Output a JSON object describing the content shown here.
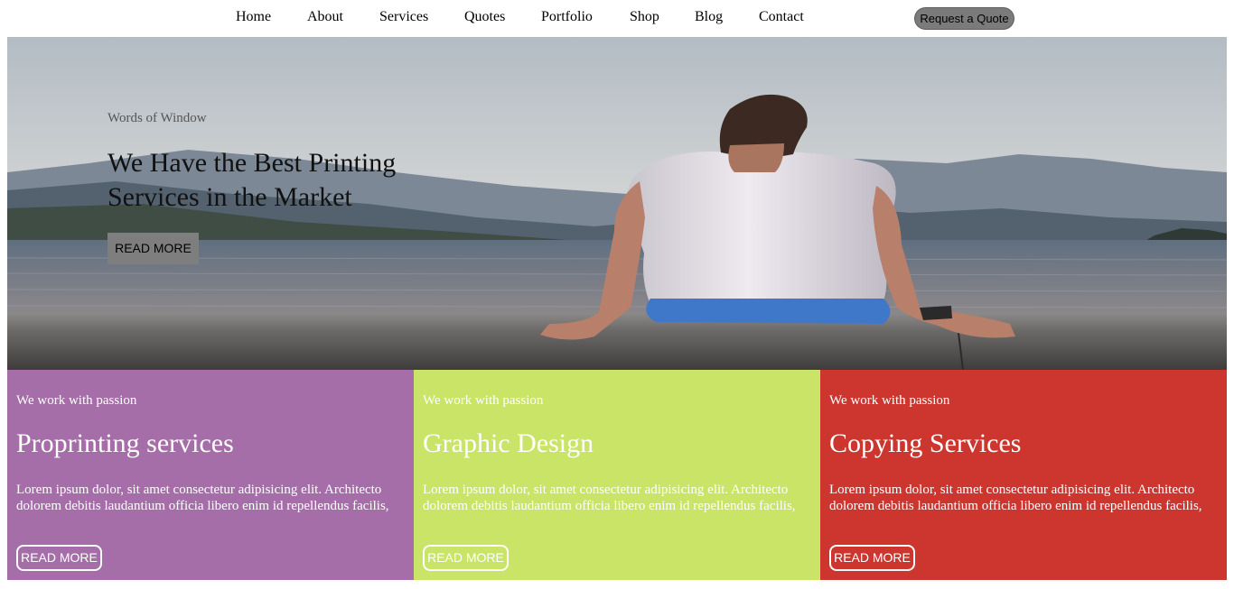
{
  "nav": {
    "items": [
      "Home",
      "About",
      "Services",
      "Quotes",
      "Portfolio",
      "Shop",
      "Blog",
      "Contact"
    ],
    "cta": "Request a Quote"
  },
  "hero": {
    "eyebrow": "Words of Window",
    "title": "We Have the Best Printing Services in the Market",
    "button": "READ MORE"
  },
  "cards": [
    {
      "kicker": "We work with passion",
      "title": "Proprinting services",
      "text": "Lorem ipsum dolor, sit amet consectetur adipisicing elit. Architecto dolorem debitis laudantium officia libero enim id repellendus facilis,",
      "button": "READ MORE",
      "color": "#a56ea8"
    },
    {
      "kicker": "We work with passion",
      "title": "Graphic Design",
      "text": "Lorem ipsum dolor, sit amet consectetur adipisicing elit. Architecto dolorem debitis laudantium officia libero enim id repellendus facilis,",
      "button": "READ MORE",
      "color": "#c9e466"
    },
    {
      "kicker": "We work with passion",
      "title": "Copying Services",
      "text": "Lorem ipsum dolor, sit amet consectetur adipisicing elit. Architecto dolorem debitis laudantium officia libero enim id repellendus facilis,",
      "button": "READ MORE",
      "color": "#cd352f"
    }
  ]
}
